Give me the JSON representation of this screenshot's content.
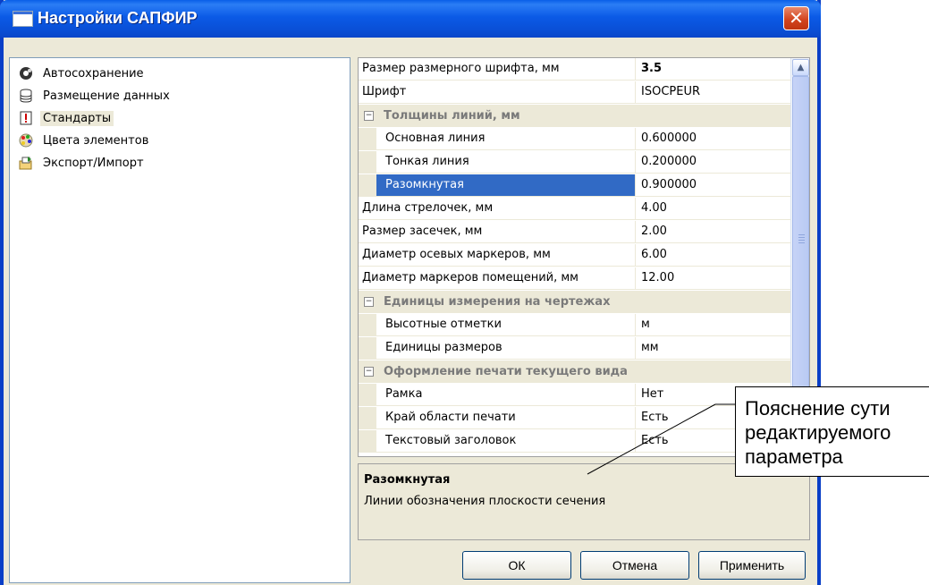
{
  "window": {
    "title": "Настройки САПФИР",
    "close_label": "✕"
  },
  "tree": {
    "items": [
      {
        "label": "Автосохранение",
        "icon": "autosave-icon",
        "selected": false
      },
      {
        "label": "Размещение данных",
        "icon": "database-icon",
        "selected": false
      },
      {
        "label": "Стандарты",
        "icon": "standards-icon",
        "selected": true
      },
      {
        "label": "Цвета элементов",
        "icon": "palette-icon",
        "selected": false
      },
      {
        "label": "Экспорт/Импорт",
        "icon": "export-import-icon",
        "selected": false
      }
    ]
  },
  "properties": {
    "rows": [
      {
        "type": "prop",
        "name": "Размер размерного шрифта, мм",
        "value": "3.5",
        "bold": true
      },
      {
        "type": "prop",
        "name": "Шрифт",
        "value": "ISOCPEUR"
      },
      {
        "type": "category",
        "name": "Толщины линий, мм",
        "expander": "⊟"
      },
      {
        "type": "sub",
        "name": "Основная линия",
        "value": "0.600000"
      },
      {
        "type": "sub",
        "name": "Тонкая линия",
        "value": "0.200000"
      },
      {
        "type": "sub",
        "name": "Разомкнутая",
        "value": "0.900000",
        "selected": true
      },
      {
        "type": "prop",
        "name": "Длина стрелочек, мм",
        "value": "4.00"
      },
      {
        "type": "prop",
        "name": "Размер засечек, мм",
        "value": "2.00"
      },
      {
        "type": "prop",
        "name": "Диаметр осевых маркеров, мм",
        "value": "6.00"
      },
      {
        "type": "prop",
        "name": "Диаметр маркеров помещений, мм",
        "value": "12.00"
      },
      {
        "type": "category",
        "name": "Единицы измерения на чертежах",
        "expander": "⊟"
      },
      {
        "type": "sub",
        "name": "Высотные отметки",
        "value": "м"
      },
      {
        "type": "sub",
        "name": "Единицы размеров",
        "value": "мм"
      },
      {
        "type": "category",
        "name": "Оформление печати текущего вида",
        "expander": "⊟"
      },
      {
        "type": "sub",
        "name": "Рамка",
        "value": "Нет"
      },
      {
        "type": "sub",
        "name": "Край области печати",
        "value": "Есть"
      },
      {
        "type": "sub",
        "name": "Текстовый заголовок",
        "value": "Есть"
      }
    ]
  },
  "description": {
    "title": "Разомкнутая",
    "text": "Линии обозначения плоскости сечения"
  },
  "buttons": {
    "ok": "ОК",
    "cancel": "Отмена",
    "apply": "Применить"
  },
  "callout": {
    "line1": "Пояснение сути",
    "line2": "редактируемого",
    "line3": "параметра"
  },
  "colors": {
    "titlebar": "#0a5fe8",
    "selection": "#316ac5",
    "dialog_bg": "#ece9d8",
    "close_button": "#d3451f"
  }
}
